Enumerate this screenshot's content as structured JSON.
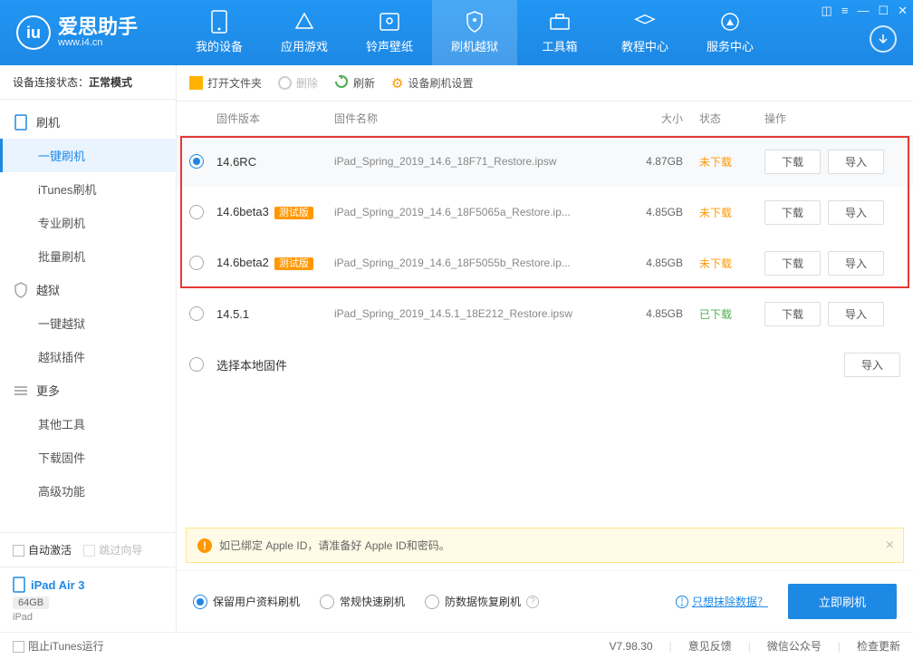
{
  "brand": {
    "name": "爱思助手",
    "domain": "www.i4.cn"
  },
  "nav": {
    "items": [
      {
        "label": "我的设备"
      },
      {
        "label": "应用游戏"
      },
      {
        "label": "铃声壁纸"
      },
      {
        "label": "刷机越狱"
      },
      {
        "label": "工具箱"
      },
      {
        "label": "教程中心"
      },
      {
        "label": "服务中心"
      }
    ]
  },
  "sidebar": {
    "status_label": "设备连接状态：",
    "status_value": "正常模式",
    "groups": [
      {
        "title": "刷机",
        "items": [
          "一键刷机",
          "iTunes刷机",
          "专业刷机",
          "批量刷机"
        ]
      },
      {
        "title": "越狱",
        "items": [
          "一键越狱",
          "越狱插件"
        ]
      },
      {
        "title": "更多",
        "items": [
          "其他工具",
          "下载固件",
          "高级功能"
        ]
      }
    ],
    "auto_activate": "自动激活",
    "skip_guide": "跳过向导",
    "device": {
      "name": "iPad Air 3",
      "capacity": "64GB",
      "type": "iPad"
    }
  },
  "toolbar": {
    "open": "打开文件夹",
    "delete": "删除",
    "refresh": "刷新",
    "settings": "设备刷机设置"
  },
  "table": {
    "headers": {
      "version": "固件版本",
      "name": "固件名称",
      "size": "大小",
      "status": "状态",
      "action": "操作"
    },
    "rows": [
      {
        "version": "14.6RC",
        "beta": "",
        "name": "iPad_Spring_2019_14.6_18F71_Restore.ipsw",
        "size": "4.87GB",
        "status": "未下载",
        "status_cls": "no",
        "selected": true
      },
      {
        "version": "14.6beta3",
        "beta": "测试版",
        "name": "iPad_Spring_2019_14.6_18F5065a_Restore.ip...",
        "size": "4.85GB",
        "status": "未下载",
        "status_cls": "no",
        "selected": false
      },
      {
        "version": "14.6beta2",
        "beta": "测试版",
        "name": "iPad_Spring_2019_14.6_18F5055b_Restore.ip...",
        "size": "4.85GB",
        "status": "未下载",
        "status_cls": "no",
        "selected": false
      },
      {
        "version": "14.5.1",
        "beta": "",
        "name": "iPad_Spring_2019_14.5.1_18E212_Restore.ipsw",
        "size": "4.85GB",
        "status": "已下载",
        "status_cls": "yes",
        "selected": false
      }
    ],
    "local": "选择本地固件",
    "btn_download": "下载",
    "btn_import": "导入"
  },
  "alert": {
    "text": "如已绑定 Apple ID，请准备好 Apple ID和密码。"
  },
  "options": {
    "keep": "保留用户资料刷机",
    "fast": "常规快速刷机",
    "recover": "防数据恢复刷机",
    "erase_link": "只想抹除数据？",
    "flash_btn": "立即刷机"
  },
  "footer": {
    "block_itunes": "阻止iTunes运行",
    "version": "V7.98.30",
    "feedback": "意见反馈",
    "wechat": "微信公众号",
    "update": "检查更新"
  }
}
